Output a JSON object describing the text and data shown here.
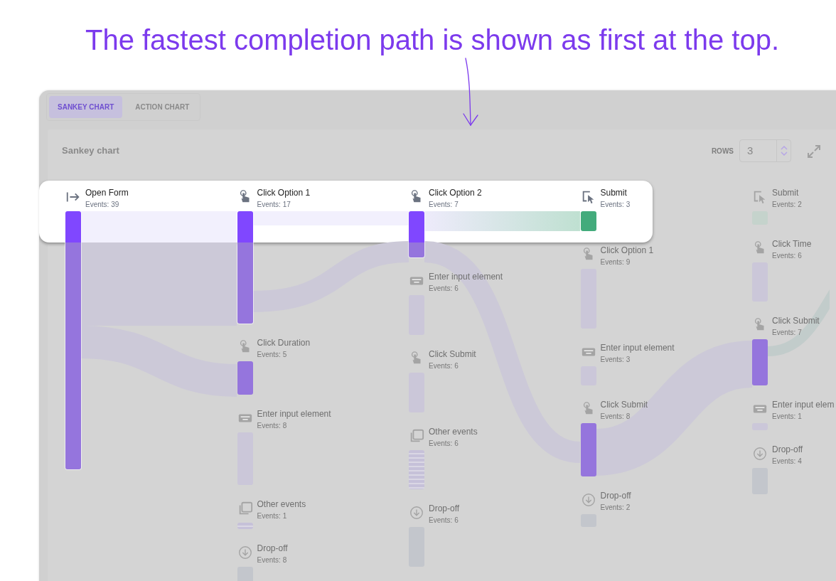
{
  "headline": "The fastest completion path is shown as first at the top.",
  "tabs": [
    {
      "label": "SANKEY CHART",
      "selected": true
    },
    {
      "label": "ACTION CHART",
      "selected": false
    }
  ],
  "panel": {
    "title": "Sankey chart",
    "rows_label": "ROWS",
    "rows_value": "3"
  },
  "columns": [
    {
      "nodes": [
        {
          "label": "Open Form",
          "events": "Events: 39",
          "kind": "open",
          "on_path": true,
          "strong": true
        }
      ]
    },
    {
      "nodes": [
        {
          "label": "Click Option 1",
          "events": "Events: 17",
          "kind": "click",
          "on_path": true,
          "strong": true
        },
        {
          "label": "Click Duration",
          "events": "Events: 5",
          "kind": "click",
          "on_path": false,
          "strong": true
        },
        {
          "label": "Enter input element",
          "events": "Events: 8",
          "kind": "input",
          "on_path": false,
          "strong": false
        },
        {
          "label": "Other events",
          "events": "Events: 1",
          "kind": "other",
          "on_path": false,
          "strong": false
        },
        {
          "label": "Drop-off",
          "events": "Events: 8",
          "kind": "drop",
          "on_path": false,
          "strong": false
        }
      ]
    },
    {
      "nodes": [
        {
          "label": "Click Option 2",
          "events": "Events: 7",
          "kind": "click",
          "on_path": true,
          "strong": true
        },
        {
          "label": "Enter input element",
          "events": "Events: 6",
          "kind": "input",
          "on_path": false,
          "strong": false
        },
        {
          "label": "Click Submit",
          "events": "Events: 6",
          "kind": "click",
          "on_path": false,
          "strong": false
        },
        {
          "label": "Other events",
          "events": "Events: 6",
          "kind": "other",
          "on_path": false,
          "strong": false
        },
        {
          "label": "Drop-off",
          "events": "Events: 6",
          "kind": "drop",
          "on_path": false,
          "strong": false
        }
      ]
    },
    {
      "nodes": [
        {
          "label": "Submit",
          "events": "Events: 3",
          "kind": "submit",
          "on_path": true,
          "strong": true
        },
        {
          "label": "Click Option 1",
          "events": "Events: 9",
          "kind": "click",
          "on_path": false,
          "strong": false
        },
        {
          "label": "Enter input element",
          "events": "Events: 3",
          "kind": "input",
          "on_path": false,
          "strong": false
        },
        {
          "label": "Click Submit",
          "events": "Events: 8",
          "kind": "click",
          "on_path": false,
          "strong": true
        },
        {
          "label": "Drop-off",
          "events": "Events: 2",
          "kind": "drop",
          "on_path": false,
          "strong": false
        }
      ]
    },
    {
      "nodes": [
        {
          "label": "Submit",
          "events": "Events: 2",
          "kind": "submit",
          "on_path": false,
          "strong": false
        },
        {
          "label": "Click Time",
          "events": "Events: 6",
          "kind": "click",
          "on_path": false,
          "strong": false
        },
        {
          "label": "Click Submit",
          "events": "Events: 7",
          "kind": "click",
          "on_path": false,
          "strong": true
        },
        {
          "label": "Enter input elem",
          "events": "Events: 1",
          "kind": "input",
          "on_path": false,
          "strong": false
        },
        {
          "label": "Drop-off",
          "events": "Events: 4",
          "kind": "drop",
          "on_path": false,
          "strong": false
        }
      ]
    }
  ]
}
